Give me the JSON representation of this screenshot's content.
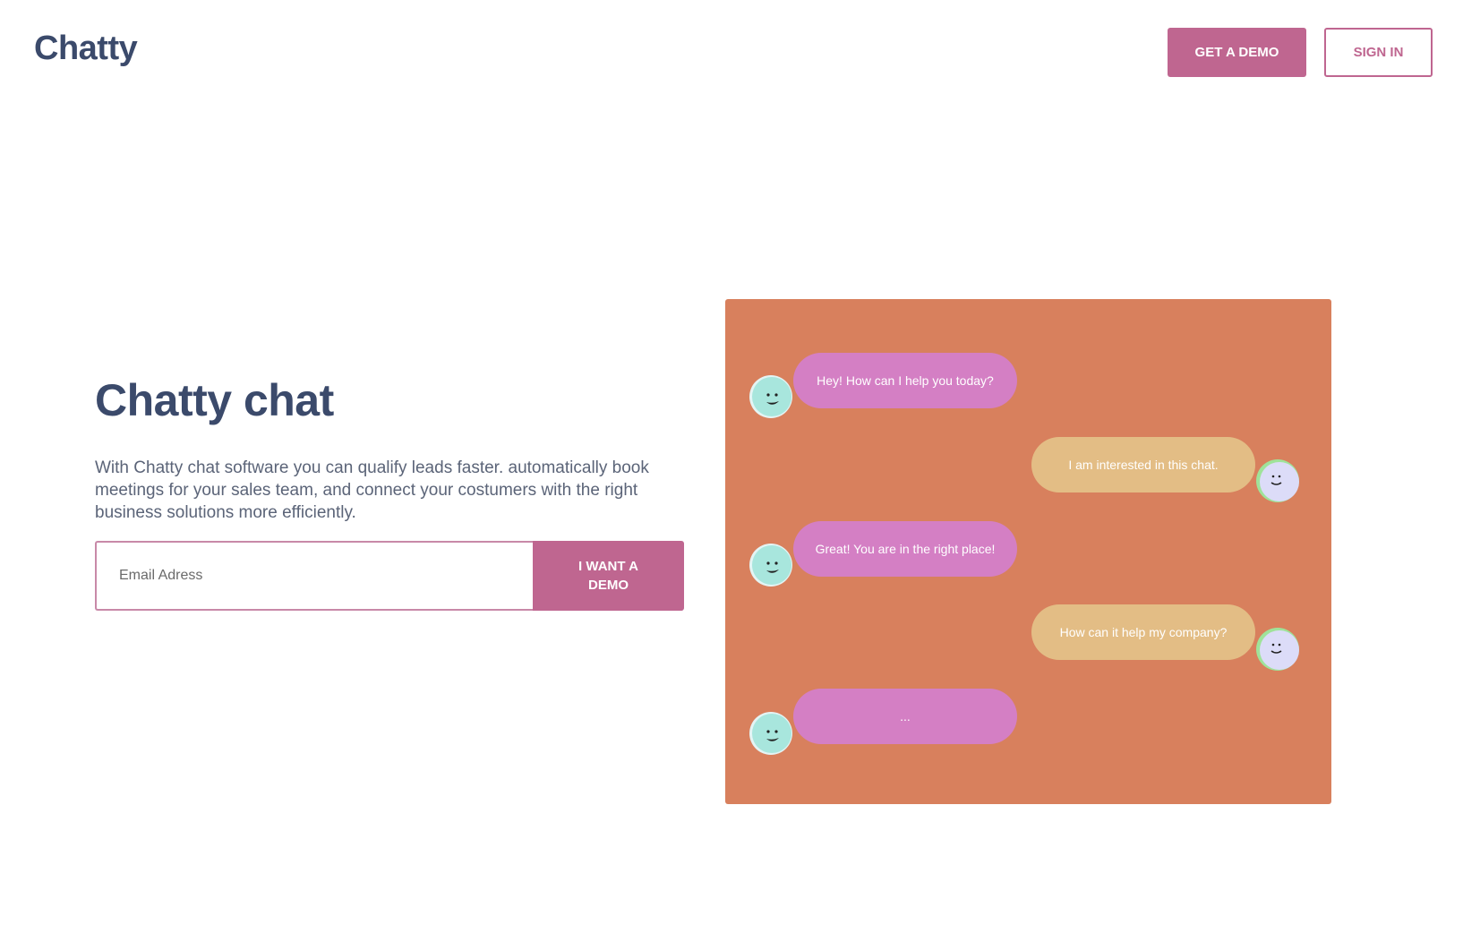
{
  "header": {
    "logo": "Chatty",
    "get_demo_label": "GET A DEMO",
    "sign_in_label": "SIGN IN"
  },
  "hero": {
    "title": "Chatty chat",
    "description": "With Chatty chat software you can qualify leads faster. automatically book meetings for your sales team, and connect your costumers with the right business solutions more efficiently.",
    "email_placeholder": "Email Adress",
    "cta_label": "I WANT A\nDEMO"
  },
  "chat": {
    "messages": [
      {
        "sender": "bot",
        "text": "Hey! How can I help you today?"
      },
      {
        "sender": "user",
        "text": "I am interested in this chat."
      },
      {
        "sender": "bot",
        "text": "Great! You are in the right place!"
      },
      {
        "sender": "user",
        "text": "How can it help my company?"
      },
      {
        "sender": "bot",
        "text": "..."
      }
    ]
  },
  "colors": {
    "brand_pink": "#bf6690",
    "heading_navy": "#3b4a6b",
    "chat_panel": "#d8805d",
    "bot_bubble": "#d47fc4",
    "user_bubble": "#e3bd85",
    "bot_avatar": "#a8e6dd",
    "user_avatar": "#dcdcf8"
  }
}
